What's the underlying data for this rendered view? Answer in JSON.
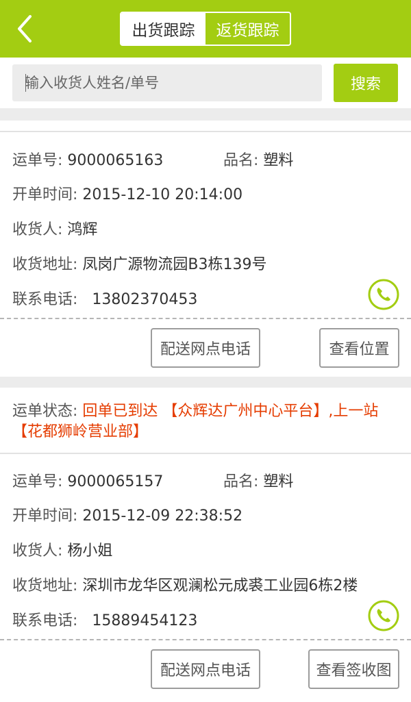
{
  "header": {
    "tabs": [
      {
        "label": "出货跟踪",
        "active": true
      },
      {
        "label": "返货跟踪",
        "active": false
      }
    ]
  },
  "search": {
    "placeholder": "输入收货人姓名/单号",
    "button_label": "搜索"
  },
  "labels": {
    "waybill": "运单号: ",
    "product": "品名: ",
    "open_time": "开单时间: ",
    "consignee": "收货人: ",
    "address": "收货地址: ",
    "phone": "联系电话:   ",
    "status": "运单状态: "
  },
  "orders": [
    {
      "waybill_no": "9000065163",
      "product": "塑料",
      "open_time": "2015-12-10 20:14:00",
      "consignee": "鸿辉",
      "address": "凤岗广源物流园B3栋139号",
      "phone": "13802370453",
      "buttons": [
        "配送网点电话",
        "查看位置"
      ]
    },
    {
      "status": "回单已到达 【众辉达广州中心平台】,上一站【花都狮岭营业部】",
      "waybill_no": "9000065157",
      "product": "塑料",
      "open_time": "2015-12-09 22:38:52",
      "consignee": "杨小姐",
      "address": "深圳市龙华区观澜松元成裘工业园6栋2楼",
      "phone": "15889454123",
      "buttons": [
        "配送网点电话",
        "查看签收图"
      ]
    }
  ],
  "colors": {
    "brand_green": "#a3cd12",
    "status_red": "#e53c00"
  },
  "icons": {
    "back": "chevron-left-icon",
    "phone": "phone-icon"
  }
}
